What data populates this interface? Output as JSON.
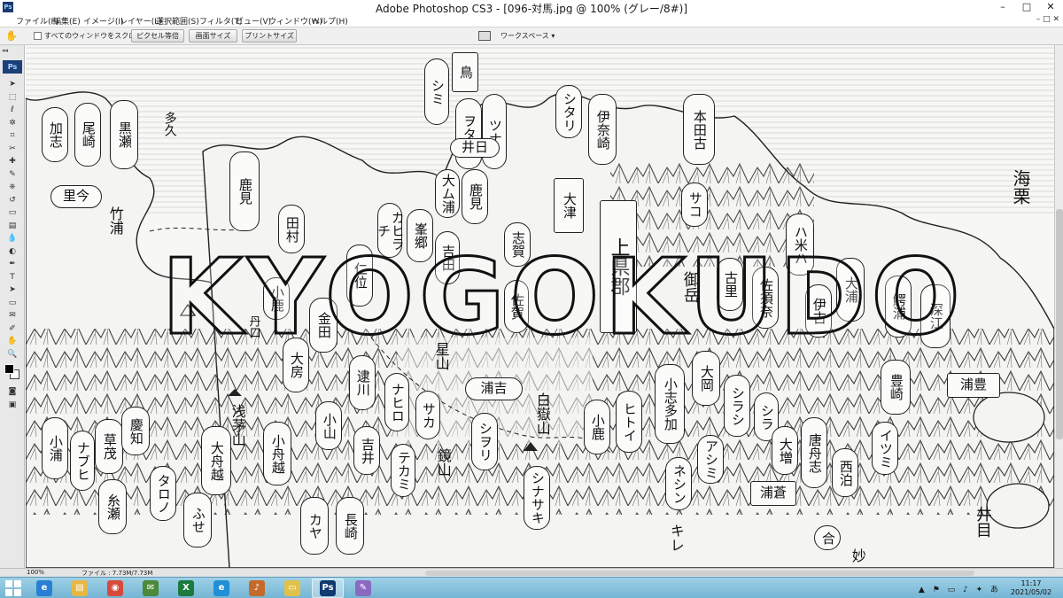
{
  "window": {
    "title": "Adobe Photoshop CS3 - [096-対馬.jpg @ 100% (グレー/8#)]",
    "app_icon": "Ps",
    "minimize": "–",
    "maximize": "□",
    "close": "✕"
  },
  "menu": {
    "items": [
      "ファイル(F)",
      "編集(E)",
      "イメージ(I)",
      "レイヤー(L)",
      "選択範囲(S)",
      "フィルタ(T)",
      "ビュー(V)",
      "ウィンドウ(W)",
      "ヘルプ(H)"
    ],
    "right_controls": "– □ ✕"
  },
  "options": {
    "tool_icon": "hand-icon",
    "scroll_all_label": "すべてのウィンドウをスクロール",
    "scroll_all_checked": false,
    "actual_pixels_label": "ピクセル等倍",
    "fit_screen_label": "画面サイズ",
    "print_size_label": "プリントサイズ",
    "workspace_label": "ワークスペース ▾"
  },
  "tools": {
    "logo": "Ps",
    "grip": "◂◂",
    "icons": [
      "move-icon",
      "marquee-icon",
      "lasso-icon",
      "magic-wand-icon",
      "crop-icon",
      "slice-icon",
      "healing-icon",
      "brush-icon",
      "stamp-icon",
      "history-brush-icon",
      "eraser-icon",
      "gradient-icon",
      "blur-icon",
      "dodge-icon",
      "pen-icon",
      "type-icon",
      "path-select-icon",
      "shape-icon",
      "notes-icon",
      "eyedropper-icon",
      "hand-icon",
      "zoom-icon"
    ],
    "glyphs": [
      "➤",
      "⬚",
      "ℓ",
      "✲",
      "⌗",
      "✂",
      "✚",
      "✎",
      "⎈",
      "↺",
      "▭",
      "▤",
      "💧",
      "◐",
      "✒",
      "T",
      "➤",
      "▭",
      "✉",
      "✐",
      "✋",
      "🔍"
    ]
  },
  "map": {
    "watermark": "KYOGOKUDO",
    "labels": [
      {
        "text": "シミ"
      },
      {
        "text": "鳥"
      },
      {
        "text": "ヲタシ"
      },
      {
        "text": "ツナ"
      },
      {
        "text": "井日"
      },
      {
        "text": "大ム浦"
      },
      {
        "text": "鹿見"
      },
      {
        "text": "峯郷"
      },
      {
        "text": "吉田"
      },
      {
        "text": "加志"
      },
      {
        "text": "尾崎"
      },
      {
        "text": "黒瀬"
      },
      {
        "text": "里今"
      },
      {
        "text": "竹浦"
      },
      {
        "text": "田村"
      },
      {
        "text": "カヒラチ"
      },
      {
        "text": "志賀"
      },
      {
        "text": "シタリ"
      },
      {
        "text": "伊奈崎"
      },
      {
        "text": "本田古"
      },
      {
        "text": "サコ"
      },
      {
        "text": "大津"
      },
      {
        "text": "上県郡"
      },
      {
        "text": "ハ米ハ"
      },
      {
        "text": "深江"
      },
      {
        "text": "大房"
      },
      {
        "text": "逮川"
      },
      {
        "text": "ナヒロ"
      },
      {
        "text": "サカ"
      },
      {
        "text": "浦吉"
      },
      {
        "text": "シヲリ"
      },
      {
        "text": "小鹿"
      },
      {
        "text": "ヒトイ"
      },
      {
        "text": "小志多加"
      },
      {
        "text": "大岡"
      },
      {
        "text": "シラシ"
      },
      {
        "text": "シラ"
      },
      {
        "text": "豊崎"
      },
      {
        "text": "浦豊"
      },
      {
        "text": "小浦"
      },
      {
        "text": "ナブヒ"
      },
      {
        "text": "草茂"
      },
      {
        "text": "慶知"
      },
      {
        "text": "糸瀬"
      },
      {
        "text": "タロノ"
      },
      {
        "text": "大舟越"
      },
      {
        "text": "ふせ"
      },
      {
        "text": "浅茅山"
      },
      {
        "text": "小舟越"
      },
      {
        "text": "小山"
      },
      {
        "text": "吉井"
      },
      {
        "text": "テカミ"
      },
      {
        "text": "鏡山"
      },
      {
        "text": "シナサキ"
      },
      {
        "text": "カヤ"
      },
      {
        "text": "長崎"
      },
      {
        "text": "アシミ"
      },
      {
        "text": "ネシン"
      },
      {
        "text": "大増"
      },
      {
        "text": "唐舟志"
      },
      {
        "text": "西泊"
      },
      {
        "text": "イツミ"
      },
      {
        "text": "浦蒼"
      },
      {
        "text": "合"
      },
      {
        "text": "海栗"
      },
      {
        "text": "御岳"
      },
      {
        "text": "星山"
      },
      {
        "text": "白嶽山"
      },
      {
        "text": "井目"
      },
      {
        "text": "鰐浦"
      },
      {
        "text": "大浦"
      },
      {
        "text": "伊古"
      },
      {
        "text": "佐須奈"
      },
      {
        "text": "古里"
      },
      {
        "text": "仁位"
      },
      {
        "text": "金田"
      },
      {
        "text": "小鹿"
      },
      {
        "text": "佐賀"
      },
      {
        "text": "鹿見"
      },
      {
        "text": "キレ"
      },
      {
        "text": "妙"
      },
      {
        "text": "丹口"
      },
      {
        "text": "多久"
      }
    ]
  },
  "status": {
    "zoom": "100%",
    "file_info": "ファイル : 7.73M/7.73M"
  },
  "taskbar": {
    "apps": [
      {
        "name": "ie",
        "glyph": "e",
        "color": "#2a7fd4"
      },
      {
        "name": "explorer",
        "glyph": "▤",
        "color": "#e7b841"
      },
      {
        "name": "chrome",
        "glyph": "◉",
        "color": "#d64a3b"
      },
      {
        "name": "mail",
        "glyph": "✉",
        "color": "#4a8a3a"
      },
      {
        "name": "excel",
        "glyph": "X",
        "color": "#1d7a3f"
      },
      {
        "name": "edge",
        "glyph": "e",
        "color": "#1f8fd6"
      },
      {
        "name": "speaker",
        "glyph": "♪",
        "color": "#c46a2a"
      },
      {
        "name": "folder",
        "glyph": "▭",
        "color": "#e0c14a"
      },
      {
        "name": "photoshop",
        "glyph": "Ps",
        "color": "#123a70"
      },
      {
        "name": "paint",
        "glyph": "✎",
        "color": "#8a6ac0"
      }
    ],
    "tray": "▲ ⚑ ▭ ♪ ✦ あ",
    "time": "11:17",
    "date": "2021/05/02"
  }
}
